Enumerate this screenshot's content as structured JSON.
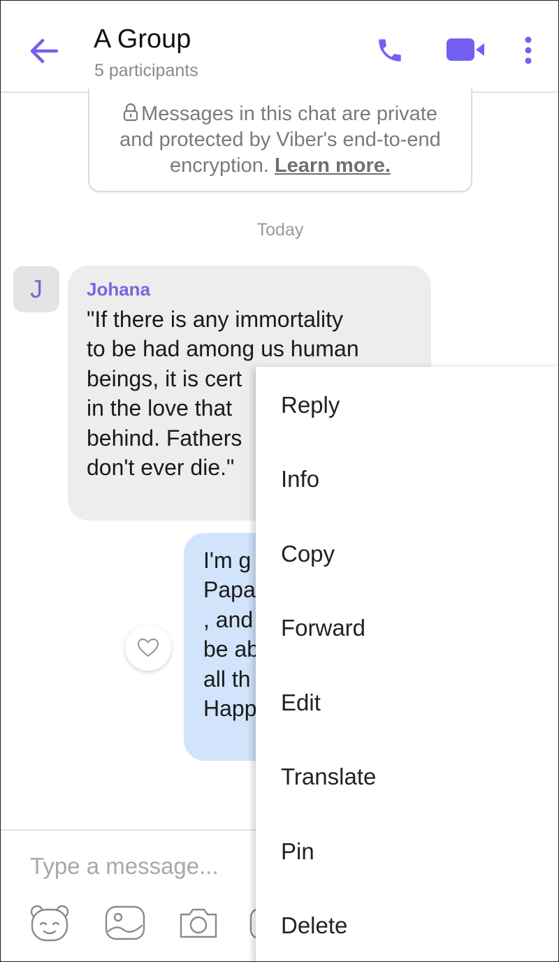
{
  "header": {
    "title": "A Group",
    "subtitle": "5 participants"
  },
  "notice": {
    "line1": "Messages in this chat are private",
    "line2": "and protected by Viber's end-to-end",
    "line3": "encryption.",
    "link": "Learn more."
  },
  "date_label": "Today",
  "incoming": {
    "avatar_initial": "J",
    "sender": "Johana",
    "lines": [
      "\"If there is any immortality",
      "to be had among us human",
      "beings, it is cert",
      "in the love that",
      "behind. Fathers",
      "don't ever die.\""
    ]
  },
  "outgoing": {
    "lines": [
      "I'm g",
      "Papa",
      ", and",
      "be ab",
      "all th",
      "Happ"
    ]
  },
  "composer": {
    "placeholder": "Type a message..."
  },
  "context_menu": {
    "items": [
      "Reply",
      "Info",
      "Copy",
      "Forward",
      "Edit",
      "Translate",
      "Pin",
      "Delete"
    ]
  },
  "colors": {
    "accent": "#7360f2",
    "incoming_bubble": "#ededed",
    "outgoing_bubble": "#d1e4fb"
  },
  "icons": {
    "back": "arrow-left-icon",
    "call": "phone-icon",
    "video": "video-camera-icon",
    "more": "more-vertical-icon",
    "lock": "lock-icon",
    "like": "heart-icon",
    "sticker": "sticker-bear-icon",
    "gallery": "gallery-icon",
    "camera": "camera-icon"
  }
}
